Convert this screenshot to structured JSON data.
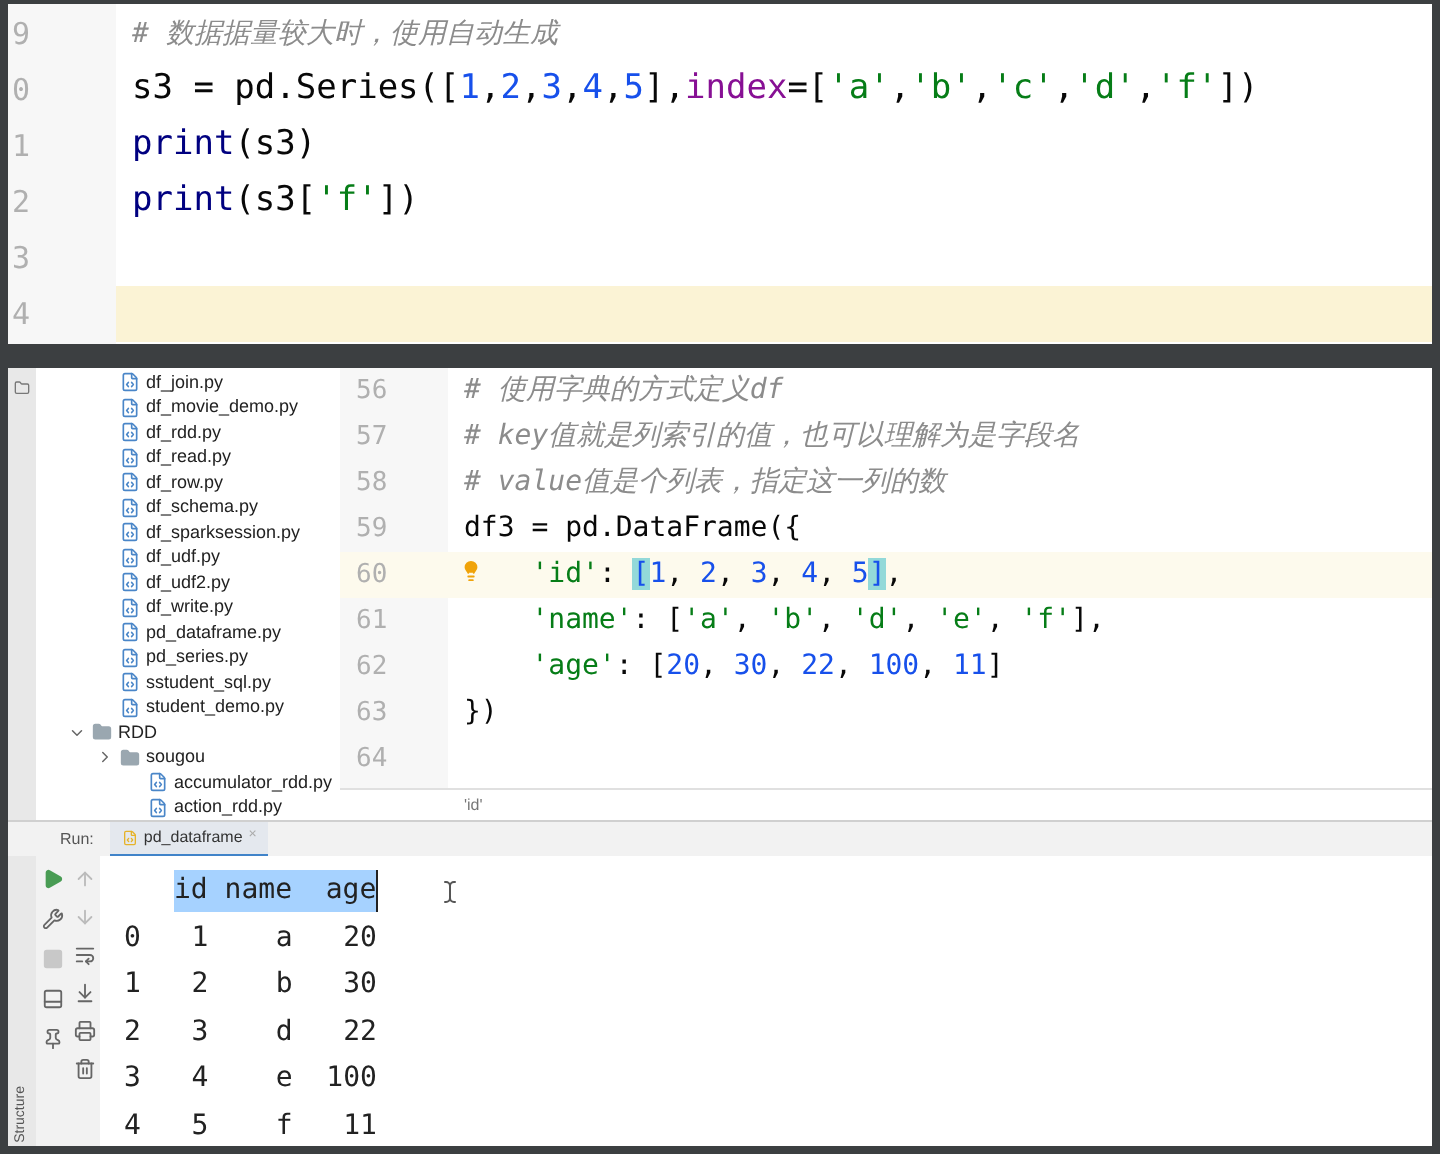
{
  "top_editor": {
    "lines": [
      {
        "number": "9",
        "current": false,
        "tokens": [
          {
            "kind": "comment",
            "text": "# 数据据量较大时，使用自动生成"
          }
        ]
      },
      {
        "number": "0",
        "current": false,
        "tokens": [
          {
            "kind": "plain",
            "text": "s3 = pd.Series(["
          },
          {
            "kind": "num",
            "text": "1"
          },
          {
            "kind": "plain",
            "text": ","
          },
          {
            "kind": "num",
            "text": "2"
          },
          {
            "kind": "plain",
            "text": ","
          },
          {
            "kind": "num",
            "text": "3"
          },
          {
            "kind": "plain",
            "text": ","
          },
          {
            "kind": "num",
            "text": "4"
          },
          {
            "kind": "plain",
            "text": ","
          },
          {
            "kind": "num",
            "text": "5"
          },
          {
            "kind": "plain",
            "text": "],"
          },
          {
            "kind": "kwarg",
            "text": "index"
          },
          {
            "kind": "plain",
            "text": "=["
          },
          {
            "kind": "str",
            "text": "'a'"
          },
          {
            "kind": "plain",
            "text": ","
          },
          {
            "kind": "str",
            "text": "'b'"
          },
          {
            "kind": "plain",
            "text": ","
          },
          {
            "kind": "str",
            "text": "'c'"
          },
          {
            "kind": "plain",
            "text": ","
          },
          {
            "kind": "str",
            "text": "'d'"
          },
          {
            "kind": "plain",
            "text": ","
          },
          {
            "kind": "str",
            "text": "'f'"
          },
          {
            "kind": "plain",
            "text": "])"
          }
        ]
      },
      {
        "number": "1",
        "current": false,
        "tokens": [
          {
            "kind": "builtin",
            "text": "print"
          },
          {
            "kind": "plain",
            "text": "(s3)"
          }
        ]
      },
      {
        "number": "2",
        "current": false,
        "tokens": [
          {
            "kind": "builtin",
            "text": "print"
          },
          {
            "kind": "plain",
            "text": "(s3["
          },
          {
            "kind": "str",
            "text": "'f'"
          },
          {
            "kind": "plain",
            "text": "])"
          }
        ]
      },
      {
        "number": "3",
        "current": false
      },
      {
        "number": "4",
        "current": true
      }
    ]
  },
  "project_tree": [
    {
      "kind": "file",
      "label": "df_join.py"
    },
    {
      "kind": "file",
      "label": "df_movie_demo.py"
    },
    {
      "kind": "file",
      "label": "df_rdd.py"
    },
    {
      "kind": "file",
      "label": "df_read.py"
    },
    {
      "kind": "file",
      "label": "df_row.py"
    },
    {
      "kind": "file",
      "label": "df_schema.py"
    },
    {
      "kind": "file",
      "label": "df_sparksession.py"
    },
    {
      "kind": "file",
      "label": "df_udf.py"
    },
    {
      "kind": "file",
      "label": "df_udf2.py"
    },
    {
      "kind": "file",
      "label": "df_write.py"
    },
    {
      "kind": "file",
      "label": "pd_dataframe.py"
    },
    {
      "kind": "file",
      "label": "pd_series.py"
    },
    {
      "kind": "file",
      "label": "sstudent_sql.py"
    },
    {
      "kind": "file",
      "label": "student_demo.py"
    },
    {
      "kind": "folder",
      "label": "RDD",
      "expanded": true,
      "children": [
        {
          "kind": "folder",
          "label": "sougou",
          "expanded": false
        },
        {
          "kind": "file",
          "label": "accumulator_rdd.py"
        },
        {
          "kind": "file",
          "label": "action_rdd.py"
        }
      ]
    }
  ],
  "editor": {
    "lines": [
      {
        "number": "56",
        "current": false,
        "bulb": false,
        "tokens": [
          {
            "kind": "comment",
            "text": "# 使用字典的方式定义df"
          }
        ]
      },
      {
        "number": "57",
        "current": false,
        "bulb": false,
        "tokens": [
          {
            "kind": "comment",
            "text": "# key值就是列索引的值，也可以理解为是字段名"
          }
        ]
      },
      {
        "number": "58",
        "current": false,
        "bulb": false,
        "tokens": [
          {
            "kind": "comment",
            "text": "# value值是个列表，指定这一列的数"
          }
        ]
      },
      {
        "number": "59",
        "current": false,
        "bulb": false,
        "tokens": [
          {
            "kind": "plain",
            "text": "df3 = pd.DataFrame({"
          }
        ]
      },
      {
        "number": "60",
        "current": true,
        "bulb": true,
        "tokens": [
          {
            "kind": "str",
            "text": "    'id'"
          },
          {
            "kind": "plain",
            "text": ": "
          },
          {
            "kind": "match",
            "text": "["
          },
          {
            "kind": "num",
            "text": "1"
          },
          {
            "kind": "plain",
            "text": ", "
          },
          {
            "kind": "num",
            "text": "2"
          },
          {
            "kind": "plain",
            "text": ", "
          },
          {
            "kind": "num",
            "text": "3"
          },
          {
            "kind": "plain",
            "text": ", "
          },
          {
            "kind": "num",
            "text": "4"
          },
          {
            "kind": "plain",
            "text": ", "
          },
          {
            "kind": "num",
            "text": "5"
          },
          {
            "kind": "match",
            "text": "]"
          },
          {
            "kind": "plain",
            "text": ","
          }
        ]
      },
      {
        "number": "61",
        "current": false,
        "bulb": false,
        "tokens": [
          {
            "kind": "str",
            "text": "    'name'"
          },
          {
            "kind": "plain",
            "text": ": ["
          },
          {
            "kind": "str",
            "text": "'a'"
          },
          {
            "kind": "plain",
            "text": ", "
          },
          {
            "kind": "str",
            "text": "'b'"
          },
          {
            "kind": "plain",
            "text": ", "
          },
          {
            "kind": "str",
            "text": "'d'"
          },
          {
            "kind": "plain",
            "text": ", "
          },
          {
            "kind": "str",
            "text": "'e'"
          },
          {
            "kind": "plain",
            "text": ", "
          },
          {
            "kind": "str",
            "text": "'f'"
          },
          {
            "kind": "plain",
            "text": "],"
          }
        ]
      },
      {
        "number": "62",
        "current": false,
        "bulb": false,
        "tokens": [
          {
            "kind": "str",
            "text": "    'age'"
          },
          {
            "kind": "plain",
            "text": ": ["
          },
          {
            "kind": "num",
            "text": "20"
          },
          {
            "kind": "plain",
            "text": ", "
          },
          {
            "kind": "num",
            "text": "30"
          },
          {
            "kind": "plain",
            "text": ", "
          },
          {
            "kind": "num",
            "text": "22"
          },
          {
            "kind": "plain",
            "text": ", "
          },
          {
            "kind": "num",
            "text": "100"
          },
          {
            "kind": "plain",
            "text": ", "
          },
          {
            "kind": "num",
            "text": "11"
          },
          {
            "kind": "plain",
            "text": "]"
          }
        ]
      },
      {
        "number": "63",
        "current": false,
        "bulb": false,
        "tokens": [
          {
            "kind": "plain",
            "text": "})"
          }
        ]
      },
      {
        "number": "64",
        "current": false,
        "bulb": false
      }
    ],
    "breadcrumb": "'id'"
  },
  "run_panel": {
    "label": "Run:",
    "tabs": [
      {
        "label": "pd_dataframe",
        "selected": true,
        "close": "×"
      }
    ],
    "side_label": "Structure",
    "header": {
      "text": "id name  age",
      "selected": true
    },
    "rows": [
      "0   1    a   20",
      "1   2    b   30",
      "2   3    d   22",
      "3   4    e  100",
      "4   5    f   11"
    ]
  }
}
